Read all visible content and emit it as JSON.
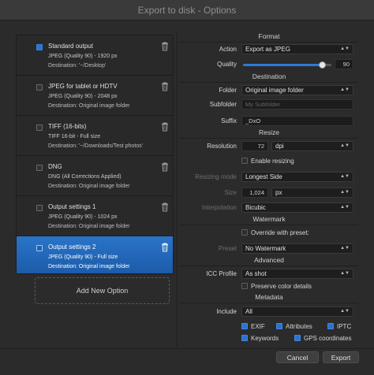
{
  "window": {
    "title": "Export to disk - Options"
  },
  "options": [
    {
      "title": "Standard output",
      "line1": "JPEG (Quality 90) - 1920 px",
      "line2": "Destination: '~/Desktop'",
      "checked": true,
      "selected": false
    },
    {
      "title": "JPEG for tablet or HDTV",
      "line1": "JPEG (Quality 90) - 2048 px",
      "line2": "Destination: Original image folder",
      "checked": false,
      "selected": false
    },
    {
      "title": "TIFF (16-bits)",
      "line1": "TIFF 16-bit - Full size",
      "line2": "Destination: '~/Downloads/Test photos'",
      "checked": false,
      "selected": false
    },
    {
      "title": "DNG",
      "line1": "DNG (All Corrections Applied)",
      "line2": "Destination: Original image folder",
      "checked": false,
      "selected": false
    },
    {
      "title": "Output settings 1",
      "line1": "JPEG (Quality 90) - 1024 px",
      "line2": "Destination: Original image folder",
      "checked": false,
      "selected": false
    },
    {
      "title": "Output settings 2",
      "line1": "JPEG (Quality 90) - Full size",
      "line2": "Destination: Original image folder",
      "checked": false,
      "selected": true
    }
  ],
  "add_option_label": "Add New Option",
  "format": {
    "section": "Format",
    "action_label": "Action",
    "action_value": "Export as JPEG",
    "quality_label": "Quality",
    "quality_value": "90",
    "quality_fraction": 0.9
  },
  "destination": {
    "section": "Destination",
    "folder_label": "Folder",
    "folder_value": "Original image folder",
    "subfolder_label": "Subfolder",
    "subfolder_placeholder": "My Subfolder",
    "suffix_label": "Suffix",
    "suffix_value": "_DxO"
  },
  "resize": {
    "section": "Resize",
    "resolution_label": "Resolution",
    "resolution_value": "72",
    "resolution_unit": "dpi",
    "enable_label": "Enable resizing",
    "enable_checked": false,
    "mode_label": "Resizing mode",
    "mode_value": "Longest Side",
    "size_label": "Size",
    "size_value": "1,024",
    "size_unit": "px",
    "interp_label": "Interpolation",
    "interp_value": "Bicubic"
  },
  "watermark": {
    "section": "Watermark",
    "override_label": "Override with preset:",
    "override_checked": false,
    "preset_label": "Preset",
    "preset_value": "No Watermark"
  },
  "advanced": {
    "section": "Advanced",
    "icc_label": "ICC Profile",
    "icc_value": "As shot",
    "preserve_label": "Preserve color details",
    "preserve_checked": false
  },
  "metadata": {
    "section": "Metadata",
    "include_label": "Include",
    "include_value": "All",
    "exif_label": "EXIF",
    "attributes_label": "Attributes",
    "iptc_label": "IPTC",
    "keywords_label": "Keywords",
    "gps_label": "GPS coordinates"
  },
  "footer": {
    "cancel_label": "Cancel",
    "export_label": "Export"
  },
  "colors": {
    "accent": "#2d72d0",
    "selected_row": "#1f62b4",
    "background": "#2b2b2b"
  },
  "icons": {
    "delete": "trash-icon",
    "dropdown": "chevron-updown-icon"
  }
}
